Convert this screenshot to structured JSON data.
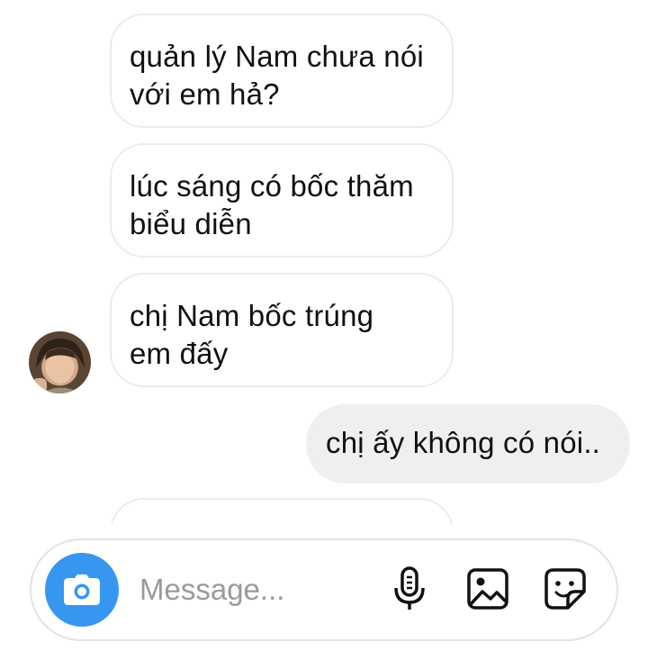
{
  "messages": [
    {
      "direction": "incoming",
      "lines": [
        "quản lý Nam chưa nói",
        "với em hả?"
      ]
    },
    {
      "direction": "incoming",
      "lines": [
        "lúc sáng có bốc thăm",
        "biểu diễn"
      ]
    },
    {
      "direction": "incoming",
      "lines": [
        "chị Nam bốc trúng",
        "em đấy"
      ]
    },
    {
      "direction": "outgoing",
      "lines": [
        "chị ấy không có nói.."
      ]
    },
    {
      "direction": "incoming",
      "lines": [
        "",
        ""
      ]
    }
  ],
  "composer": {
    "placeholder": "Message...",
    "accent_color": "#3797f0",
    "icons": [
      "camera-icon",
      "microphone-icon",
      "gallery-icon",
      "sticker-icon"
    ]
  }
}
